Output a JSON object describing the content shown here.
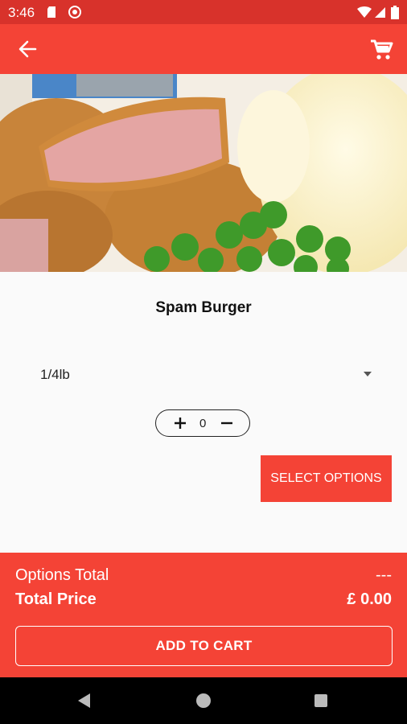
{
  "status_bar": {
    "time": "3:46"
  },
  "product": {
    "title": "Spam Burger"
  },
  "size_select": {
    "value": "1/4lb"
  },
  "quantity": {
    "value": "0"
  },
  "select_options_button": {
    "label": "SELECT OPTIONS"
  },
  "footer": {
    "options_total_label": "Options Total",
    "options_total_value": "---",
    "total_price_label": "Total Price",
    "total_price_value": "£ 0.00",
    "add_to_cart_label": "ADD TO CART"
  },
  "colors": {
    "accent": "#f44336",
    "status_bar": "#d8322b"
  }
}
